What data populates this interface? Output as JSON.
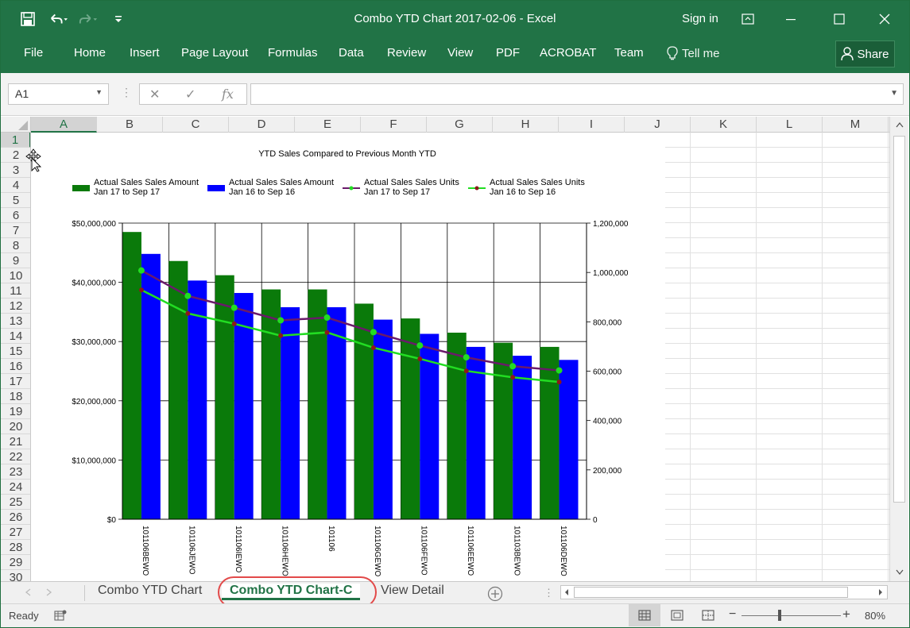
{
  "window": {
    "title": "Combo YTD Chart 2017-02-06 - Excel",
    "signin": "Sign in",
    "share": "Share"
  },
  "ribbon": {
    "tabs": [
      "File",
      "Home",
      "Insert",
      "Page Layout",
      "Formulas",
      "Data",
      "Review",
      "View",
      "PDF",
      "ACROBAT",
      "Team",
      "Tell me"
    ]
  },
  "formula_bar": {
    "name_box": "A1",
    "fx": "fx",
    "content": ""
  },
  "grid": {
    "columns": [
      "A",
      "B",
      "C",
      "D",
      "E",
      "F",
      "G",
      "H",
      "I",
      "J",
      "K",
      "L",
      "M"
    ],
    "rows": [
      "1",
      "2",
      "3",
      "4",
      "5",
      "6",
      "7",
      "8",
      "9",
      "10",
      "11",
      "12",
      "13",
      "14",
      "15",
      "16",
      "17",
      "18",
      "19",
      "20",
      "21",
      "22",
      "23",
      "24",
      "25",
      "26",
      "27",
      "28",
      "29",
      "30"
    ],
    "selected_column": "A",
    "selected_row": "1"
  },
  "chart_data": {
    "type": "bar",
    "title": "YTD Sales Compared to Previous Month YTD",
    "categories": [
      "101106BEWO",
      "101106JEWO",
      "101106IEWO",
      "101106HEWO",
      "101106",
      "101106GEWO",
      "101106FEWO",
      "101106EEWO",
      "101103BEWO",
      "101106DEWO"
    ],
    "series": [
      {
        "name": "Actual Sales Sales Amount Jan 17 to Sep 17",
        "legend_line1": "Actual Sales Sales Amount",
        "legend_line2": "Jan 17 to Sep 17",
        "type": "bar",
        "axis": "left",
        "color": "#0a7a0a",
        "values": [
          48500000,
          43600000,
          41200000,
          38800000,
          38800000,
          36400000,
          33900000,
          31500000,
          29800000,
          29100000
        ]
      },
      {
        "name": "Actual Sales Sales Amount Jan 16 to Sep 16",
        "legend_line1": "Actual Sales Sales Amount",
        "legend_line2": "Jan 16 to Sep 16",
        "type": "bar",
        "axis": "left",
        "color": "#0000ff",
        "values": [
          44800000,
          40300000,
          38200000,
          35800000,
          35800000,
          33700000,
          31300000,
          29100000,
          27600000,
          26900000
        ]
      },
      {
        "name": "Actual Sales Sales Units Jan 17 to Sep 17",
        "legend_line1": "Actual Sales Sales Units",
        "legend_line2": "Jan 17 to Sep 17",
        "type": "line",
        "axis": "right",
        "color": "#6a1a6a",
        "marker_color": "#22dd22",
        "values": [
          1008000,
          905000,
          857000,
          806000,
          817000,
          758000,
          704000,
          656000,
          620000,
          603000
        ]
      },
      {
        "name": "Actual Sales Sales Units Jan 16 to Sep 16",
        "legend_line1": "Actual Sales Sales Units",
        "legend_line2": "Jan 16 to Sep 16",
        "type": "line",
        "axis": "right",
        "color": "#22dd22",
        "marker_color": "#8b1a1a",
        "values": [
          929000,
          834000,
          792000,
          744000,
          757000,
          695000,
          650000,
          601000,
          575000,
          556000
        ]
      }
    ],
    "y_left": {
      "min": 0,
      "max": 50000000,
      "ticks": [
        0,
        10000000,
        20000000,
        30000000,
        40000000,
        50000000
      ],
      "tick_labels": [
        "$0",
        "$10,000,000",
        "$20,000,000",
        "$30,000,000",
        "$40,000,000",
        "$50,000,000"
      ]
    },
    "y_right": {
      "min": 0,
      "max": 1200000,
      "ticks": [
        0,
        200000,
        400000,
        600000,
        800000,
        1000000,
        1200000
      ],
      "tick_labels": [
        "0",
        "200,000",
        "400,000",
        "600,000",
        "800,000",
        "1,000,000",
        "1,200,000"
      ]
    },
    "legend": "top",
    "grid": true
  },
  "sheets": {
    "tabs": [
      "Combo YTD Chart",
      "Combo YTD Chart-C",
      "View Detail"
    ],
    "active": "Combo YTD Chart-C"
  },
  "status": {
    "text": "Ready",
    "zoom": "80%"
  }
}
